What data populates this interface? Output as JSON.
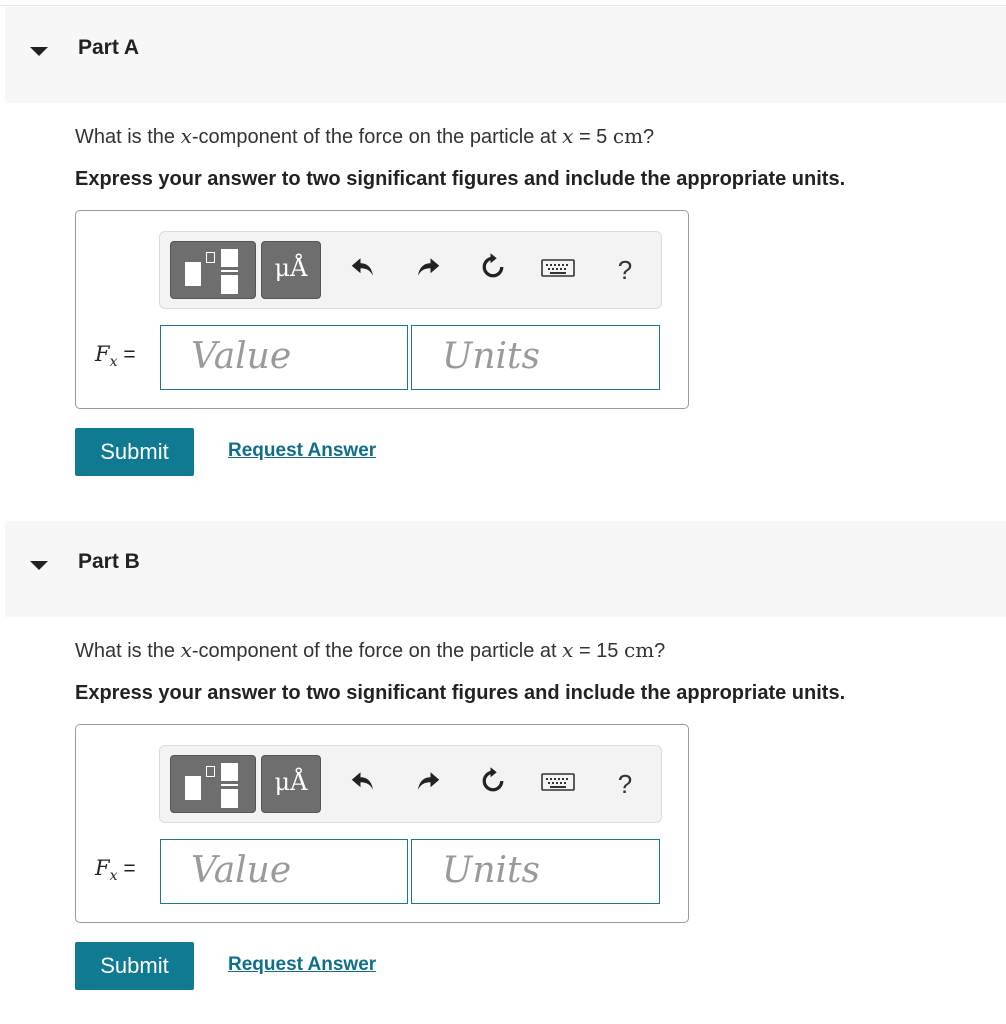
{
  "parts": [
    {
      "title": "Part A",
      "question_prefix": "What is the ",
      "question_var": "x",
      "question_mid": "-component of the force on the particle at ",
      "question_var2": "x",
      "question_eq": " = 5 ",
      "question_unit": "cm",
      "question_suffix": "?",
      "instruction": "Express your answer to two significant figures and include the appropriate units.",
      "fx_symbol": "F",
      "fx_subscript": "x",
      "fx_equals": " =",
      "value_placeholder": "Value",
      "units_placeholder": "Units",
      "units_button_label": "μÅ",
      "help_label": "?",
      "submit_label": "Submit",
      "request_label": "Request Answer"
    },
    {
      "title": "Part B",
      "question_prefix": "What is the ",
      "question_var": "x",
      "question_mid": "-component of the force on the particle at ",
      "question_var2": "x",
      "question_eq": " = 15 ",
      "question_unit": "cm",
      "question_suffix": "?",
      "instruction": "Express your answer to two significant figures and include the appropriate units.",
      "fx_symbol": "F",
      "fx_subscript": "x",
      "fx_equals": " =",
      "value_placeholder": "Value",
      "units_placeholder": "Units",
      "units_button_label": "μÅ",
      "help_label": "?",
      "submit_label": "Submit",
      "request_label": "Request Answer"
    }
  ],
  "icons": {
    "toggle": "caret-down-icon",
    "templates": "templates-icon",
    "units": "units-icon",
    "undo": "undo-icon",
    "redo": "redo-icon",
    "reset": "reset-icon",
    "keyboard": "keyboard-icon",
    "help": "help-icon"
  },
  "colors": {
    "accent": "#0f7a92",
    "link": "#0f6e8a",
    "field_border": "#1a7a8c",
    "header_bg": "#f7f7f7",
    "toolbar_dark": "#6e6e6e"
  }
}
